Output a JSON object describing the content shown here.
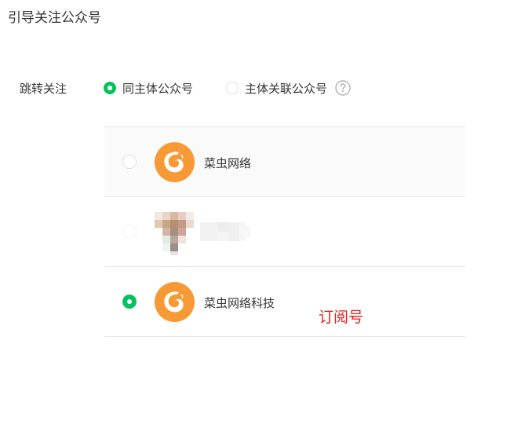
{
  "page": {
    "title": "引导关注公众号"
  },
  "jump_follow": {
    "label": "跳转关注",
    "options": [
      {
        "label": "同主体公众号",
        "selected": true
      },
      {
        "label": "主体关联公众号",
        "selected": false
      }
    ],
    "help_icon": "question-circle-icon"
  },
  "accounts": [
    {
      "name": "菜虫网络",
      "selected": false,
      "avatar_icon": "orange-logo"
    },
    {
      "name": "",
      "selected": false,
      "avatar_icon": "pixelated-avatar",
      "obscured": true
    },
    {
      "name": "菜虫网络科技",
      "selected": true,
      "avatar_icon": "orange-logo"
    }
  ],
  "annotation": {
    "text": "订阅号",
    "color": "#e0201c"
  },
  "colors": {
    "accent": "#07c160",
    "logo_orange": "#f79a35",
    "divider": "#e7e7eb"
  }
}
